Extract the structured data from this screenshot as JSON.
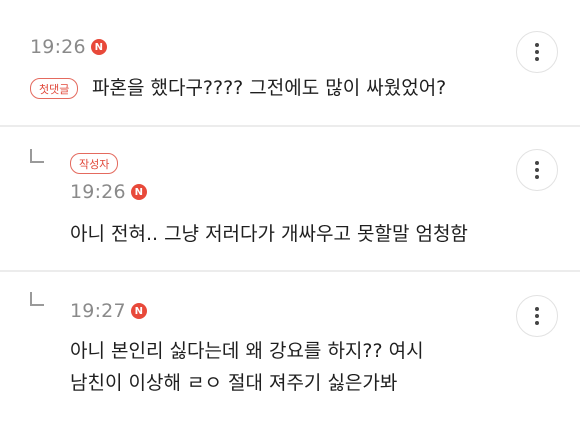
{
  "comments": [
    {
      "time": "19:26",
      "badge": "N",
      "tag": "첫댓글",
      "text": "파혼을 했다구???? 그전에도 많이 싸웠었어?"
    },
    {
      "time": "19:26",
      "badge": "N",
      "tag": "작성자",
      "text": "아니 전혀.. 그냥 저러다가 개싸우고 못할말 엄청함"
    },
    {
      "time": "19:27",
      "badge": "N",
      "text_line1": "아니 본인리 싫다는데 왜 강요를 하지?? 여시",
      "text_line2": "남친이 이상해 ㄹㅇ 절대 져주기 싫은가봐"
    }
  ],
  "icons": {
    "more": "more-vertical-icon",
    "reply": "reply-arrow-icon"
  },
  "colors": {
    "badge": "#e8493a",
    "tag": "#e0483a",
    "time": "#8a8a8a"
  }
}
